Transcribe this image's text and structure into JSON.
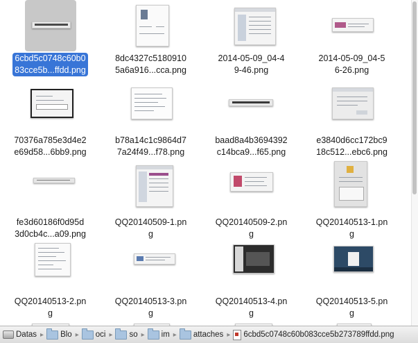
{
  "files": [
    {
      "line1": "6cbd5c0748c60b0",
      "line2": "83cce5b...ffdd.png",
      "selected": true
    },
    {
      "line1": "8dc4327c5180910",
      "line2": "5a6a916...cca.png"
    },
    {
      "line1": "2014-05-09_04-4",
      "line2": "9-46.png"
    },
    {
      "line1": "2014-05-09_04-5",
      "line2": "6-26.png"
    },
    {
      "line1": "70376a785e3d4e2",
      "line2": "e69d58...6bb9.png"
    },
    {
      "line1": "b78a14c1c9864d7",
      "line2": "7a24f49...f78.png"
    },
    {
      "line1": "baad8a4b3694392",
      "line2": "c14bca9...f65.png"
    },
    {
      "line1": "e3840d6cc172bc9",
      "line2": "18c512...ebc6.png"
    },
    {
      "line1": "fe3d60186f0d95d",
      "line2": "3d0cb4c...a09.png"
    },
    {
      "line1": "QQ20140509-1.pn",
      "line2": "g"
    },
    {
      "line1": "QQ20140509-2.pn",
      "line2": "g"
    },
    {
      "line1": "QQ20140513-1.pn",
      "line2": "g"
    },
    {
      "line1": "QQ20140513-2.pn",
      "line2": "g"
    },
    {
      "line1": "QQ20140513-3.pn",
      "line2": "g"
    },
    {
      "line1": "QQ20140513-4.pn",
      "line2": "g"
    },
    {
      "line1": "QQ20140513-5.pn",
      "line2": "g"
    }
  ],
  "pathbar": {
    "crumbs": [
      "Datas",
      "Blo",
      "oci",
      "so",
      "im",
      "attaches"
    ],
    "file": "6cbd5c0748c60b083cce5b273789ffdd.png"
  },
  "colors": {
    "selection": "#3875d7",
    "selected_thumb_bg": "#c8c8c8"
  }
}
